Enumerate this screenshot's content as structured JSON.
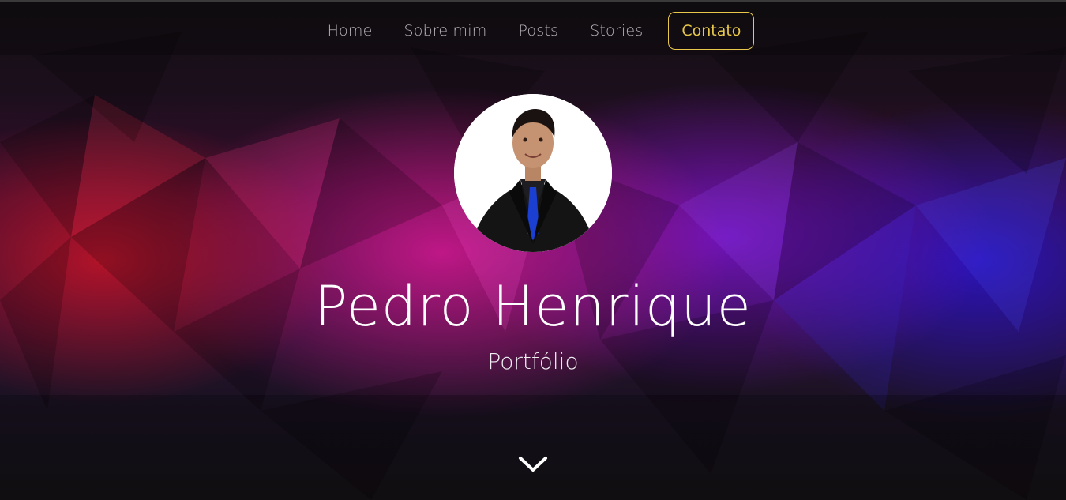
{
  "nav": {
    "items": [
      {
        "label": "Home"
      },
      {
        "label": "Sobre mim"
      },
      {
        "label": "Posts"
      },
      {
        "label": "Stories"
      }
    ],
    "contact_label": "Contato"
  },
  "hero": {
    "name": "Pedro Henrique",
    "subtitle": "Portfólio",
    "avatar_icon": "profile-photo",
    "scroll_icon": "chevron-down-icon"
  },
  "colors": {
    "accent": "#e8c84b",
    "nav_text": "#b9b4ba",
    "heading": "#ffffff"
  }
}
